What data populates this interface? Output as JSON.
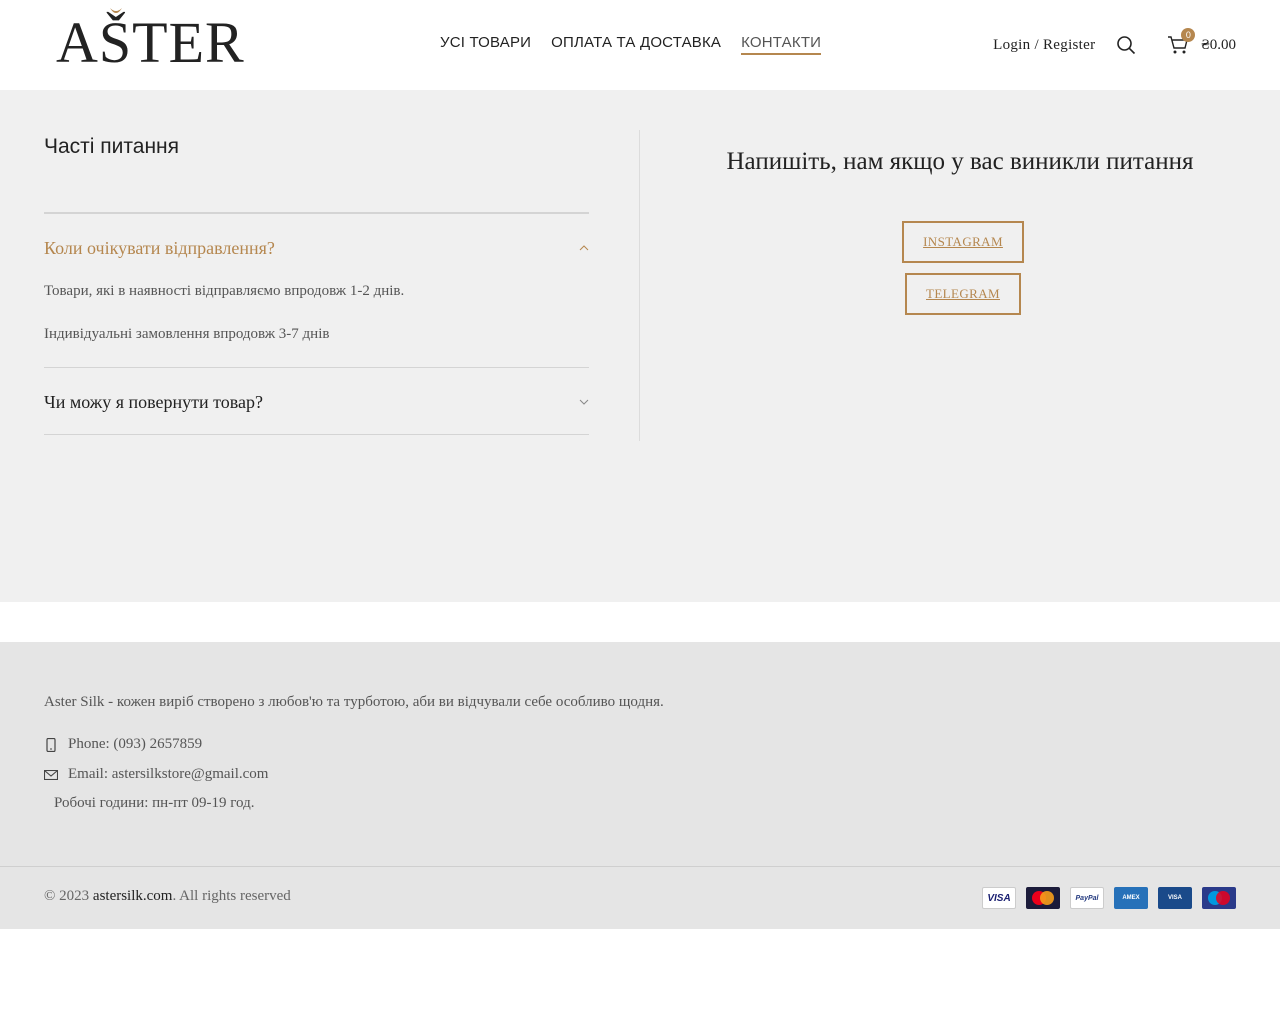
{
  "header": {
    "logo_text": "AŠTER",
    "nav": [
      {
        "label": "УСІ ТОВАРИ",
        "active": false
      },
      {
        "label": "ОПЛАТА ТА ДОСТАВКА",
        "active": false
      },
      {
        "label": "КОНТАКТИ",
        "active": true
      }
    ],
    "login_label": "Login / Register",
    "search_icon": "search-icon",
    "cart_icon": "cart-icon",
    "cart_count": "0",
    "cart_total": "₴0.00",
    "accent_color": "#b5874f"
  },
  "faq": {
    "title": "Часті питання",
    "items": [
      {
        "question": "Коли очікувати відправлення?",
        "open": true,
        "answer": [
          "Товари, які в наявності відправляємо впродовж 1-2 днів.",
          "Індивідуальні замовлення впродовж 3-7 днів"
        ]
      },
      {
        "question": "Чи можу я повернути товар?",
        "open": false,
        "answer": []
      }
    ]
  },
  "contact": {
    "title": "Напишіть, нам якщо у вас виникли питання",
    "instagram_label": "Instagram",
    "telegram_label": "Telegram"
  },
  "footer": {
    "about": "Aster Silk - кожен виріб створено з любов'ю та турботою, аби ви відчували себе особливо щодня.",
    "phone": "Phone: (093) 2657859",
    "email": "Email: astersilkstore@gmail.com",
    "hours": "Робочі години: пн-пт 09-19 год.",
    "copyright_prefix": "© 2023",
    "copyright_site": "astersilk.com",
    "copyright_suffix": ". All rights reserved",
    "payment_methods": [
      {
        "name": "visa",
        "label": "VISA"
      },
      {
        "name": "mastercard",
        "label": "MasterCard"
      },
      {
        "name": "paypal",
        "label": "PayPal"
      },
      {
        "name": "american-express",
        "label": "AMERICAN EXPRESS"
      },
      {
        "name": "visa-electron",
        "label": "VISA Electron"
      },
      {
        "name": "maestro",
        "label": "Maestro"
      }
    ]
  }
}
